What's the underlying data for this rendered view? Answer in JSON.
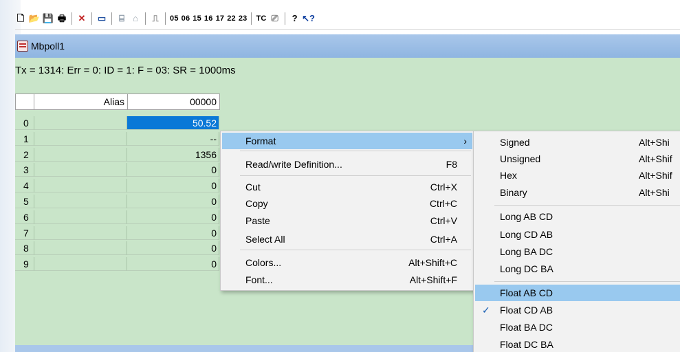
{
  "toolbar": {
    "icons": [
      "new-icon",
      "open-icon",
      "save-icon",
      "print-icon",
      "delete-icon",
      "window-icon",
      "connect-icon",
      "disconnect-icon",
      "pulse-icon"
    ],
    "codes": [
      "05",
      "06",
      "15",
      "16",
      "17",
      "22",
      "23",
      "TC"
    ],
    "help_icons": [
      "help-icon",
      "context-help-icon"
    ]
  },
  "window": {
    "title": "Mbpoll1",
    "status": "Tx = 1314: Err = 0: ID = 1: F = 03: SR = 1000ms"
  },
  "table": {
    "headers": {
      "alias": "Alias",
      "address": "00000"
    },
    "rows": [
      {
        "index": "0",
        "value": "50.52"
      },
      {
        "index": "1",
        "value": "--"
      },
      {
        "index": "2",
        "value": "1356"
      },
      {
        "index": "3",
        "value": "0"
      },
      {
        "index": "4",
        "value": "0"
      },
      {
        "index": "5",
        "value": "0"
      },
      {
        "index": "6",
        "value": "0"
      },
      {
        "index": "7",
        "value": "0"
      },
      {
        "index": "8",
        "value": "0"
      },
      {
        "index": "9",
        "value": "0"
      }
    ]
  },
  "context_menu": {
    "items": [
      {
        "label": "Format",
        "shortcut": ""
      },
      {
        "label": "Read/write Definition...",
        "shortcut": "F8"
      },
      {
        "label": "Cut",
        "shortcut": "Ctrl+X"
      },
      {
        "label": "Copy",
        "shortcut": "Ctrl+C"
      },
      {
        "label": "Paste",
        "shortcut": "Ctrl+V"
      },
      {
        "label": "Select All",
        "shortcut": "Ctrl+A"
      },
      {
        "label": "Colors...",
        "shortcut": "Alt+Shift+C"
      },
      {
        "label": "Font...",
        "shortcut": "Alt+Shift+F"
      }
    ],
    "submenu_arrow": "›"
  },
  "format_menu": {
    "items": [
      {
        "label": "Signed",
        "shortcut": "Alt+Shi"
      },
      {
        "label": "Unsigned",
        "shortcut": "Alt+Shif"
      },
      {
        "label": "Hex",
        "shortcut": "Alt+Shif"
      },
      {
        "label": "Binary",
        "shortcut": "Alt+Shi"
      },
      {
        "label": "Long AB CD",
        "shortcut": ""
      },
      {
        "label": "Long CD AB",
        "shortcut": ""
      },
      {
        "label": "Long BA DC",
        "shortcut": ""
      },
      {
        "label": "Long DC BA",
        "shortcut": ""
      },
      {
        "label": "Float AB CD",
        "shortcut": ""
      },
      {
        "label": "Float CD AB",
        "shortcut": ""
      },
      {
        "label": "Float BA DC",
        "shortcut": ""
      },
      {
        "label": "Float DC BA",
        "shortcut": ""
      }
    ],
    "check_mark": "✓"
  },
  "colors": {
    "green_bg": "#c9e5c9",
    "title_blue": "#a9c7ea",
    "selection_blue": "#0a78d7",
    "menu_highlight": "#99c9ef"
  }
}
